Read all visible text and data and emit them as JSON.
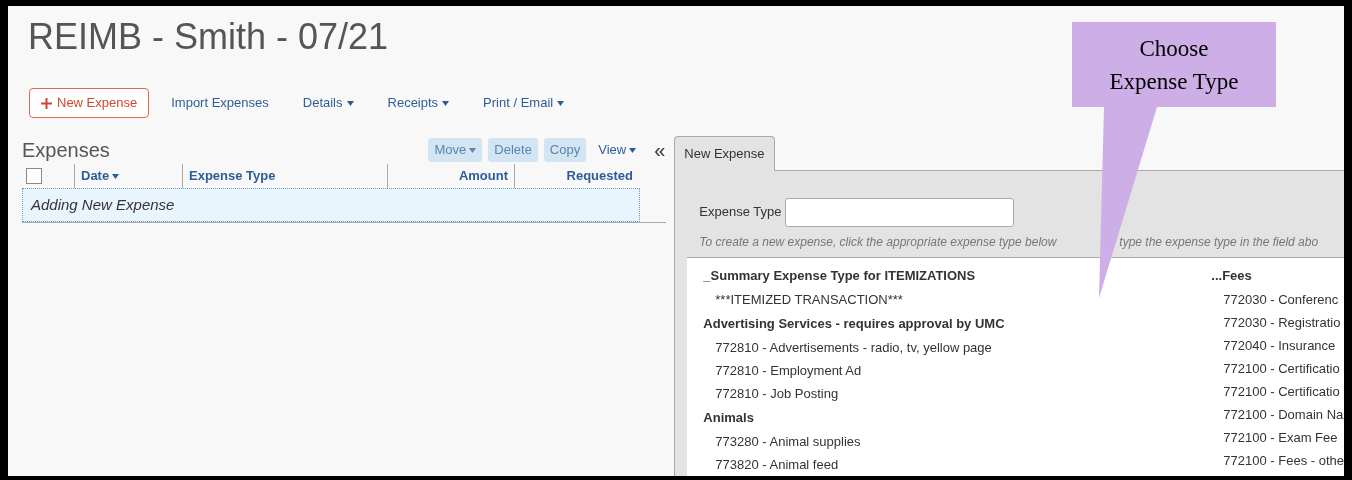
{
  "title": "REIMB - Smith - 07/21",
  "toolbar": [
    {
      "label": "New Expense",
      "kind": "primary"
    },
    {
      "label": "Import Expenses",
      "kind": "link"
    },
    {
      "label": "Details",
      "kind": "menu"
    },
    {
      "label": "Receipts",
      "kind": "menu"
    },
    {
      "label": "Print / Email",
      "kind": "menu"
    }
  ],
  "expenses": {
    "title": "Expenses",
    "actions": [
      {
        "label": "Move",
        "kind": "menu",
        "disabled": true
      },
      {
        "label": "Delete",
        "kind": "plain",
        "disabled": true
      },
      {
        "label": "Copy",
        "kind": "plain",
        "disabled": true
      },
      {
        "label": "View",
        "kind": "menu",
        "disabled": false
      }
    ],
    "collapse_label": "«",
    "select_all_checked": false,
    "columns": [
      {
        "label": "Date",
        "sorted": true
      },
      {
        "label": "Expense Type",
        "sorted": false
      },
      {
        "label": "Amount",
        "sorted": false
      },
      {
        "label": "Requested",
        "sorted": false
      }
    ],
    "rows": [
      {
        "text": "Adding New Expense",
        "selected": true
      }
    ]
  },
  "detail": {
    "tabs": [
      {
        "label": "New Expense",
        "selected": true
      }
    ],
    "field": {
      "label": "Expense Type"
    },
    "hint_parts": [
      "To create a new expense, click the appropriate expense type below",
      "type the expense type in the field abo"
    ],
    "type_columns": [
      [
        {
          "heading": "_Summary Expense Type for ITEMIZATIONS",
          "items": [
            "***ITEMIZED TRANSACTION***"
          ]
        },
        {
          "heading": "Advertising Services - requires approval by UMC",
          "items": [
            "772810 - Advertisements - radio, tv, yellow page",
            "772810 - Employment Ad",
            "772810 - Job Posting"
          ]
        },
        {
          "heading": "Animals",
          "items": [
            "773280 - Animal supplies",
            "773820 - Animal feed"
          ]
        }
      ],
      [
        {
          "heading": "...Fees",
          "items": [
            "772030 - Conferenc",
            "772030 - Registratio",
            "772040 - Insurance",
            "772100 - Certificatio",
            "772100 - Certificatio",
            "772100 - Domain Na",
            "772100 - Exam Fee",
            "772100 - Fees - othe"
          ]
        }
      ]
    ]
  },
  "callout": {
    "text": "Choose Expense Type"
  }
}
